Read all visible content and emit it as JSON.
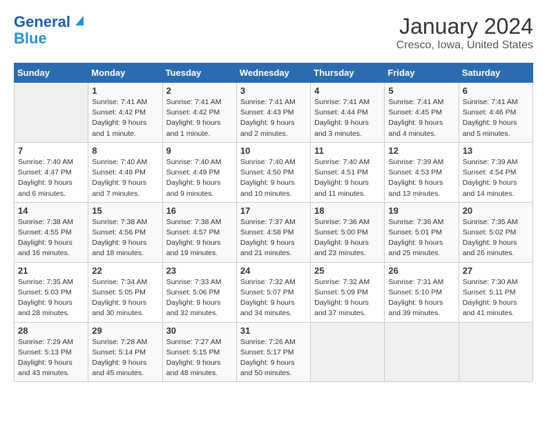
{
  "logo": {
    "line1": "General",
    "line2": "Blue"
  },
  "title": "January 2024",
  "subtitle": "Cresco, Iowa, United States",
  "days_header": [
    "Sunday",
    "Monday",
    "Tuesday",
    "Wednesday",
    "Thursday",
    "Friday",
    "Saturday"
  ],
  "weeks": [
    [
      {
        "day": "",
        "sunrise": "",
        "sunset": "",
        "daylight": ""
      },
      {
        "day": "1",
        "sunrise": "Sunrise: 7:41 AM",
        "sunset": "Sunset: 4:42 PM",
        "daylight": "Daylight: 9 hours and 1 minute."
      },
      {
        "day": "2",
        "sunrise": "Sunrise: 7:41 AM",
        "sunset": "Sunset: 4:42 PM",
        "daylight": "Daylight: 9 hours and 1 minute."
      },
      {
        "day": "3",
        "sunrise": "Sunrise: 7:41 AM",
        "sunset": "Sunset: 4:43 PM",
        "daylight": "Daylight: 9 hours and 2 minutes."
      },
      {
        "day": "4",
        "sunrise": "Sunrise: 7:41 AM",
        "sunset": "Sunset: 4:44 PM",
        "daylight": "Daylight: 9 hours and 3 minutes."
      },
      {
        "day": "5",
        "sunrise": "Sunrise: 7:41 AM",
        "sunset": "Sunset: 4:45 PM",
        "daylight": "Daylight: 9 hours and 4 minutes."
      },
      {
        "day": "6",
        "sunrise": "Sunrise: 7:41 AM",
        "sunset": "Sunset: 4:46 PM",
        "daylight": "Daylight: 9 hours and 5 minutes."
      }
    ],
    [
      {
        "day": "7",
        "sunrise": "Sunrise: 7:40 AM",
        "sunset": "Sunset: 4:47 PM",
        "daylight": "Daylight: 9 hours and 6 minutes."
      },
      {
        "day": "8",
        "sunrise": "Sunrise: 7:40 AM",
        "sunset": "Sunset: 4:48 PM",
        "daylight": "Daylight: 9 hours and 7 minutes."
      },
      {
        "day": "9",
        "sunrise": "Sunrise: 7:40 AM",
        "sunset": "Sunset: 4:49 PM",
        "daylight": "Daylight: 9 hours and 9 minutes."
      },
      {
        "day": "10",
        "sunrise": "Sunrise: 7:40 AM",
        "sunset": "Sunset: 4:50 PM",
        "daylight": "Daylight: 9 hours and 10 minutes."
      },
      {
        "day": "11",
        "sunrise": "Sunrise: 7:40 AM",
        "sunset": "Sunset: 4:51 PM",
        "daylight": "Daylight: 9 hours and 11 minutes."
      },
      {
        "day": "12",
        "sunrise": "Sunrise: 7:39 AM",
        "sunset": "Sunset: 4:53 PM",
        "daylight": "Daylight: 9 hours and 13 minutes."
      },
      {
        "day": "13",
        "sunrise": "Sunrise: 7:39 AM",
        "sunset": "Sunset: 4:54 PM",
        "daylight": "Daylight: 9 hours and 14 minutes."
      }
    ],
    [
      {
        "day": "14",
        "sunrise": "Sunrise: 7:38 AM",
        "sunset": "Sunset: 4:55 PM",
        "daylight": "Daylight: 9 hours and 16 minutes."
      },
      {
        "day": "15",
        "sunrise": "Sunrise: 7:38 AM",
        "sunset": "Sunset: 4:56 PM",
        "daylight": "Daylight: 9 hours and 18 minutes."
      },
      {
        "day": "16",
        "sunrise": "Sunrise: 7:38 AM",
        "sunset": "Sunset: 4:57 PM",
        "daylight": "Daylight: 9 hours and 19 minutes."
      },
      {
        "day": "17",
        "sunrise": "Sunrise: 7:37 AM",
        "sunset": "Sunset: 4:58 PM",
        "daylight": "Daylight: 9 hours and 21 minutes."
      },
      {
        "day": "18",
        "sunrise": "Sunrise: 7:36 AM",
        "sunset": "Sunset: 5:00 PM",
        "daylight": "Daylight: 9 hours and 23 minutes."
      },
      {
        "day": "19",
        "sunrise": "Sunrise: 7:36 AM",
        "sunset": "Sunset: 5:01 PM",
        "daylight": "Daylight: 9 hours and 25 minutes."
      },
      {
        "day": "20",
        "sunrise": "Sunrise: 7:35 AM",
        "sunset": "Sunset: 5:02 PM",
        "daylight": "Daylight: 9 hours and 26 minutes."
      }
    ],
    [
      {
        "day": "21",
        "sunrise": "Sunrise: 7:35 AM",
        "sunset": "Sunset: 5:03 PM",
        "daylight": "Daylight: 9 hours and 28 minutes."
      },
      {
        "day": "22",
        "sunrise": "Sunrise: 7:34 AM",
        "sunset": "Sunset: 5:05 PM",
        "daylight": "Daylight: 9 hours and 30 minutes."
      },
      {
        "day": "23",
        "sunrise": "Sunrise: 7:33 AM",
        "sunset": "Sunset: 5:06 PM",
        "daylight": "Daylight: 9 hours and 32 minutes."
      },
      {
        "day": "24",
        "sunrise": "Sunrise: 7:32 AM",
        "sunset": "Sunset: 5:07 PM",
        "daylight": "Daylight: 9 hours and 34 minutes."
      },
      {
        "day": "25",
        "sunrise": "Sunrise: 7:32 AM",
        "sunset": "Sunset: 5:09 PM",
        "daylight": "Daylight: 9 hours and 37 minutes."
      },
      {
        "day": "26",
        "sunrise": "Sunrise: 7:31 AM",
        "sunset": "Sunset: 5:10 PM",
        "daylight": "Daylight: 9 hours and 39 minutes."
      },
      {
        "day": "27",
        "sunrise": "Sunrise: 7:30 AM",
        "sunset": "Sunset: 5:11 PM",
        "daylight": "Daylight: 9 hours and 41 minutes."
      }
    ],
    [
      {
        "day": "28",
        "sunrise": "Sunrise: 7:29 AM",
        "sunset": "Sunset: 5:13 PM",
        "daylight": "Daylight: 9 hours and 43 minutes."
      },
      {
        "day": "29",
        "sunrise": "Sunrise: 7:28 AM",
        "sunset": "Sunset: 5:14 PM",
        "daylight": "Daylight: 9 hours and 45 minutes."
      },
      {
        "day": "30",
        "sunrise": "Sunrise: 7:27 AM",
        "sunset": "Sunset: 5:15 PM",
        "daylight": "Daylight: 9 hours and 48 minutes."
      },
      {
        "day": "31",
        "sunrise": "Sunrise: 7:26 AM",
        "sunset": "Sunset: 5:17 PM",
        "daylight": "Daylight: 9 hours and 50 minutes."
      },
      {
        "day": "",
        "sunrise": "",
        "sunset": "",
        "daylight": ""
      },
      {
        "day": "",
        "sunrise": "",
        "sunset": "",
        "daylight": ""
      },
      {
        "day": "",
        "sunrise": "",
        "sunset": "",
        "daylight": ""
      }
    ]
  ]
}
